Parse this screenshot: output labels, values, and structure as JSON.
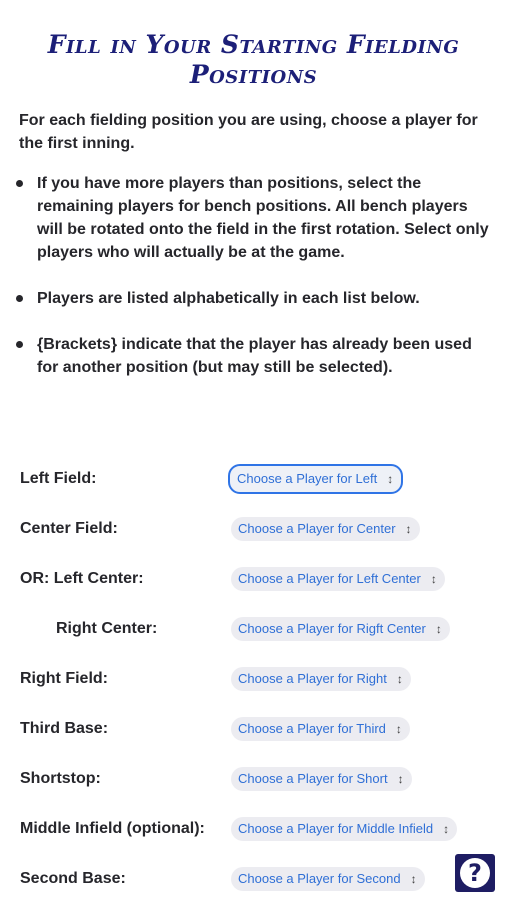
{
  "header": {
    "title_line1": "Fill in Your Starting Fielding",
    "title_line2": "Positions"
  },
  "intro": "For each fielding position you are using, choose a player for the first inning.",
  "bullets": [
    "If you have more players than positions, select the remaining players for bench positions. All bench players will be rotated onto the field in the first rotation. Select only players who will actually be at the game.",
    "Players are listed alphabetically in each list below.",
    "{Brackets} indicate that the player has already been used for another position (but may still be selected)."
  ],
  "positions": [
    {
      "label": "Left Field:",
      "select": "Choose a Player for Left"
    },
    {
      "label": "Center Field:",
      "select": "Choose a Player for Center"
    },
    {
      "label": "OR: Left Center:",
      "select": "Choose a Player for Left Center"
    },
    {
      "label": "Right Center:",
      "select": "Choose a Player for Rigft Center"
    },
    {
      "label": "Right Field:",
      "select": "Choose a Player for Right"
    },
    {
      "label": "Third Base:",
      "select": "Choose a Player for Third"
    },
    {
      "label": "Shortstop:",
      "select": "Choose a Player for Short"
    },
    {
      "label": "Middle Infield (optional):",
      "select": "Choose a Player for Middle Infield"
    },
    {
      "label": "Second Base:",
      "select": "Choose a Player for Second"
    }
  ],
  "help": {
    "glyph": "?",
    "icon": "question-mark-icon"
  },
  "colors": {
    "title": "#1c1f78",
    "select_text": "#2f6fd6",
    "help_bg": "#1e1d63",
    "focus_border": "#2f74e6"
  }
}
